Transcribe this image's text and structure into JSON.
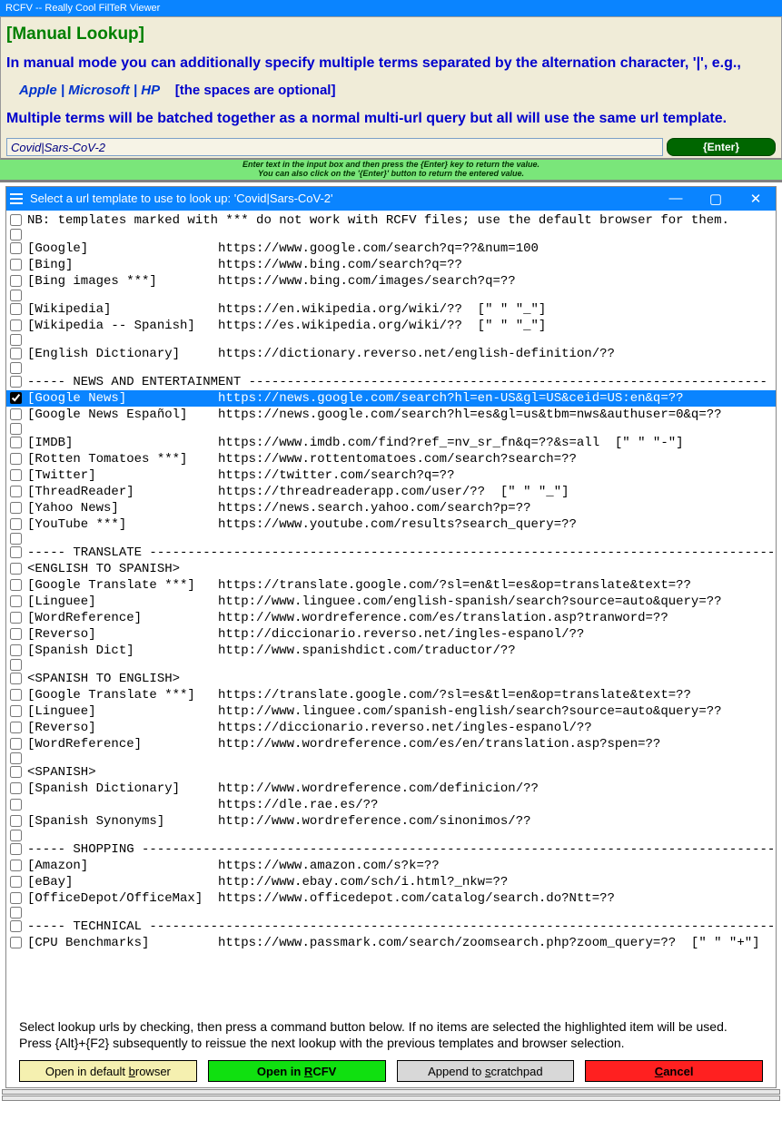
{
  "app_title": "RCFV -- Really Cool FilTeR Viewer",
  "header": {
    "title": "[Manual Lookup]",
    "line1": "In manual mode you can additionally specify multiple terms separated by the alternation character, '|', e.g.,",
    "example_terms": "Apple | Microsoft | HP",
    "example_note": "[the spaces are optional]",
    "line2": "Multiple terms will be batched together as a normal multi-url query but all will use the same url template."
  },
  "input": {
    "value": "Covid|Sars-CoV-2",
    "enter_label": "{Enter}"
  },
  "hint": {
    "l1": "Enter text in the input box and then press the {Enter} key to return the value.",
    "l2": "You can also click on the '{Enter}' button to return the entered value."
  },
  "dialog_title": "Select a url template to use to look up: 'Covid|Sars-CoV-2'",
  "rows": [
    {
      "s": false,
      "c": false,
      "t": "NB: templates marked with *** do not work with RCFV files; use the default browser for them."
    },
    {
      "s": false,
      "c": false,
      "t": ""
    },
    {
      "s": false,
      "c": false,
      "t": "[Google]                 https://www.google.com/search?q=??&num=100"
    },
    {
      "s": false,
      "c": false,
      "t": "[Bing]                   https://www.bing.com/search?q=??"
    },
    {
      "s": false,
      "c": false,
      "t": "[Bing images ***]        https://www.bing.com/images/search?q=??"
    },
    {
      "s": false,
      "c": false,
      "t": ""
    },
    {
      "s": false,
      "c": false,
      "t": "[Wikipedia]              https://en.wikipedia.org/wiki/??  [\" \" \"_\"]"
    },
    {
      "s": false,
      "c": false,
      "t": "[Wikipedia -- Spanish]   https://es.wikipedia.org/wiki/??  [\" \" \"_\"]"
    },
    {
      "s": false,
      "c": false,
      "t": ""
    },
    {
      "s": false,
      "c": false,
      "t": "[English Dictionary]     https://dictionary.reverso.net/english-definition/??"
    },
    {
      "s": false,
      "c": false,
      "t": ""
    },
    {
      "s": false,
      "c": false,
      "t": "----- NEWS AND ENTERTAINMENT --------------------------------------------------------------------"
    },
    {
      "s": true,
      "c": true,
      "t": "[Google News]            https://news.google.com/search?hl=en-US&gl=US&ceid=US:en&q=??"
    },
    {
      "s": false,
      "c": false,
      "t": "[Google News Español]    https://news.google.com/search?hl=es&gl=us&tbm=nws&authuser=0&q=??"
    },
    {
      "s": false,
      "c": false,
      "t": ""
    },
    {
      "s": false,
      "c": false,
      "t": "[IMDB]                   https://www.imdb.com/find?ref_=nv_sr_fn&q=??&s=all  [\" \" \"-\"]"
    },
    {
      "s": false,
      "c": false,
      "t": "[Rotten Tomatoes ***]    https://www.rottentomatoes.com/search?search=??"
    },
    {
      "s": false,
      "c": false,
      "t": "[Twitter]                https://twitter.com/search?q=??"
    },
    {
      "s": false,
      "c": false,
      "t": "[ThreadReader]           https://threadreaderapp.com/user/??  [\" \" \"_\"]"
    },
    {
      "s": false,
      "c": false,
      "t": "[Yahoo News]             https://news.search.yahoo.com/search?p=??"
    },
    {
      "s": false,
      "c": false,
      "t": "[YouTube ***]            https://www.youtube.com/results?search_query=??"
    },
    {
      "s": false,
      "c": false,
      "t": ""
    },
    {
      "s": false,
      "c": false,
      "t": "----- TRANSLATE ----------------------------------------------------------------------------------"
    },
    {
      "s": false,
      "c": false,
      "t": "<ENGLISH TO SPANISH>"
    },
    {
      "s": false,
      "c": false,
      "t": "[Google Translate ***]   https://translate.google.com/?sl=en&tl=es&op=translate&text=??"
    },
    {
      "s": false,
      "c": false,
      "t": "[Linguee]                http://www.linguee.com/english-spanish/search?source=auto&query=??"
    },
    {
      "s": false,
      "c": false,
      "t": "[WordReference]          http://www.wordreference.com/es/translation.asp?tranword=??"
    },
    {
      "s": false,
      "c": false,
      "t": "[Reverso]                http://diccionario.reverso.net/ingles-espanol/??"
    },
    {
      "s": false,
      "c": false,
      "t": "[Spanish Dict]           http://www.spanishdict.com/traductor/??"
    },
    {
      "s": false,
      "c": false,
      "t": ""
    },
    {
      "s": false,
      "c": false,
      "t": "<SPANISH TO ENGLISH>"
    },
    {
      "s": false,
      "c": false,
      "t": "[Google Translate ***]   https://translate.google.com/?sl=es&tl=en&op=translate&text=??"
    },
    {
      "s": false,
      "c": false,
      "t": "[Linguee]                http://www.linguee.com/spanish-english/search?source=auto&query=??"
    },
    {
      "s": false,
      "c": false,
      "t": "[Reverso]                https://diccionario.reverso.net/ingles-espanol/??"
    },
    {
      "s": false,
      "c": false,
      "t": "[WordReference]          http://www.wordreference.com/es/en/translation.asp?spen=??"
    },
    {
      "s": false,
      "c": false,
      "t": ""
    },
    {
      "s": false,
      "c": false,
      "t": "<SPANISH>"
    },
    {
      "s": false,
      "c": false,
      "t": "[Spanish Dictionary]     http://www.wordreference.com/definicion/??"
    },
    {
      "s": false,
      "c": false,
      "t": "                         https://dle.rae.es/??"
    },
    {
      "s": false,
      "c": false,
      "t": "[Spanish Synonyms]       http://www.wordreference.com/sinonimos/??"
    },
    {
      "s": false,
      "c": false,
      "t": ""
    },
    {
      "s": false,
      "c": false,
      "t": "----- SHOPPING -----------------------------------------------------------------------------------"
    },
    {
      "s": false,
      "c": false,
      "t": "[Amazon]                 https://www.amazon.com/s?k=??"
    },
    {
      "s": false,
      "c": false,
      "t": "[eBay]                   http://www.ebay.com/sch/i.html?_nkw=??"
    },
    {
      "s": false,
      "c": false,
      "t": "[OfficeDepot/OfficeMax]  https://www.officedepot.com/catalog/search.do?Ntt=??"
    },
    {
      "s": false,
      "c": false,
      "t": ""
    },
    {
      "s": false,
      "c": false,
      "t": "----- TECHNICAL ----------------------------------------------------------------------------------"
    },
    {
      "s": false,
      "c": false,
      "t": "[CPU Benchmarks]         https://www.passmark.com/search/zoomsearch.php?zoom_query=??  [\" \" \"+\"]"
    }
  ],
  "footer_text": "Select lookup urls by checking, then press a command button below. If no items are selected the highlighted item will be used. Press {Alt}+{F2} subsequently to reissue the next lookup with the previous templates and browser selection.",
  "buttons": {
    "b1": "Open in default browser",
    "b2": "Open in RCFV",
    "b3": "Append to scratchpad",
    "b4": "Cancel"
  }
}
